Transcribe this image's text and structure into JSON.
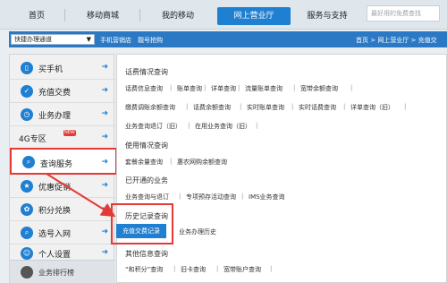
{
  "topnav": {
    "tabs": [
      {
        "label": "首页"
      },
      {
        "label": "移动商城"
      },
      {
        "label": "我的移动"
      },
      {
        "label": "网上营业厅"
      },
      {
        "label": "服务与支持"
      }
    ],
    "search_placeholder": "最好用的免费查找"
  },
  "bluebar": {
    "channel_select": "快捷办理通道",
    "links": [
      "手机营销店",
      "靓号抢购"
    ],
    "breadcrumb": "首页 > 网上营业厅 > 充值交"
  },
  "sidebar": {
    "items": [
      {
        "label": "买手机",
        "icon": "phone-icon"
      },
      {
        "label": "充值交费",
        "icon": "recharge-icon"
      },
      {
        "label": "业务办理",
        "icon": "service-icon"
      },
      {
        "label": "4G专区",
        "icon": "4g-icon",
        "badge": "NEW"
      },
      {
        "label": "查询服务",
        "icon": "query-icon"
      },
      {
        "label": "优惠促销",
        "icon": "promo-icon"
      },
      {
        "label": "积分兑换",
        "icon": "points-icon"
      },
      {
        "label": "选号入网",
        "icon": "number-icon"
      },
      {
        "label": "个人设置",
        "icon": "user-icon"
      }
    ],
    "footer": "业务排行榜"
  },
  "main": {
    "sections": [
      {
        "title": "话费情况查询",
        "rows": [
          [
            "话费信息查询",
            "账单查询",
            "详单查询",
            "流量账单查询",
            "宽带余额查询"
          ],
          [
            "缴费调账余额查询",
            "话费余额查询",
            "实时账单查询",
            "实时话费查询",
            "详单查询（旧）"
          ],
          [
            "业务查询退订（旧）",
            "在用业务查询（旧）"
          ]
        ]
      },
      {
        "title": "使用情况查询",
        "rows": [
          [
            "套餐余量查询",
            "惠农网购余额查询"
          ]
        ]
      },
      {
        "title": "已开通的业务",
        "rows": [
          [
            "业务查询与退订",
            "专项预存活动查询",
            "IMS业务查询"
          ]
        ]
      },
      {
        "title": "历史记录查询",
        "rows": [
          [
            "充值交费记录",
            "业务办理历史"
          ]
        ]
      },
      {
        "title": "其他信息查询",
        "rows": [
          [
            "“和积分”查询",
            "旧卡查询",
            "宽带账户查询"
          ]
        ]
      }
    ]
  },
  "colors": {
    "accent": "#1f7fd1",
    "highlight": "#e53935"
  }
}
